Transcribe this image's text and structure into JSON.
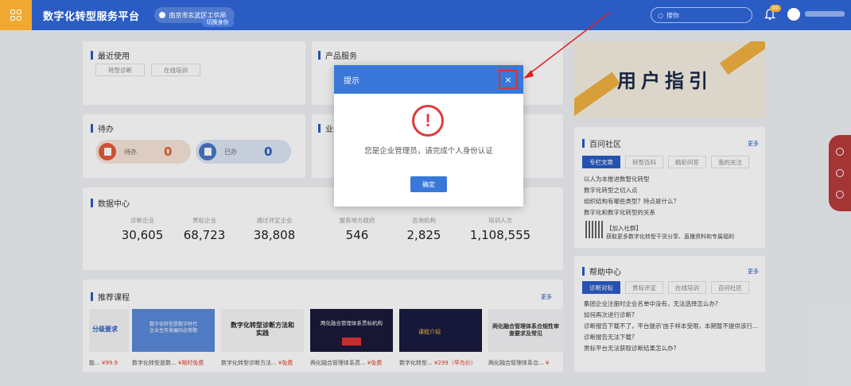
{
  "app": {
    "title": "数字化转型服务平台",
    "org": "南京市玄武区工信局",
    "org_sub": "切换身份"
  },
  "topbar": {
    "search_placeholder": "搜你"
  },
  "recent": {
    "title": "最近使用",
    "items": [
      "转型诊断",
      "在线培训"
    ]
  },
  "products": {
    "title": "产品服务"
  },
  "todo": {
    "title": "待办",
    "pending_label": "待办",
    "pending_count": "0",
    "done_label": "已办",
    "done_count": "0"
  },
  "business": {
    "title": "业务"
  },
  "data_center": {
    "title": "数据中心",
    "stats": [
      {
        "label": "诊断企业",
        "value": "30,605"
      },
      {
        "label": "贯标企业",
        "value": "68,723"
      },
      {
        "label": "通过评定企业",
        "value": "38,808"
      },
      {
        "label": "服务地方政府",
        "value": "546"
      },
      {
        "label": "咨询机构",
        "value": "2,825"
      },
      {
        "label": "培训人次",
        "value": "1,108,555"
      }
    ]
  },
  "courses": {
    "title": "推荐课程",
    "more": "更多",
    "items": [
      {
        "name": "能...",
        "price": "¥99.9"
      },
      {
        "name": "数字化转型是数...",
        "price": "¥限时免费"
      },
      {
        "name": "数字化转型诊断方法...",
        "price": "¥免费"
      },
      {
        "name": "两化融合管理体系贯...",
        "price": "¥免费"
      },
      {
        "name": "数字化转型...",
        "price": "¥299（早鸟价）"
      },
      {
        "name": "两化融合管理体系合...",
        "price": "¥"
      }
    ],
    "thumb_texts": [
      "分级要求",
      "数字化转型是数字时代企业生存发展的必答题",
      "数字化转型诊断方法和实践",
      "两化融合管理体系贯标机构",
      "课程介绍",
      "两化融合管理体系合规性审查要求及常见"
    ]
  },
  "guide": {
    "title": "用户指引"
  },
  "community": {
    "title": "百问社区",
    "more": "更多",
    "tabs": [
      "专栏文章",
      "转型百科",
      "精彩问答",
      "我的关注"
    ],
    "lines": [
      "以人为本推进数智化转型",
      "数字化转型之切入点",
      "组织结构有哪些类型？特点是什么？",
      "数字化和数字化转型的关系"
    ],
    "qr_title": "【加入社群】",
    "qr_desc": "获取更多数字化转型干货分享、直播资料和专属福利"
  },
  "help": {
    "title": "帮助中心",
    "more": "更多",
    "tabs": [
      "诊断对标",
      "贯标评定",
      "在线培训",
      "百问社区"
    ],
    "lines": [
      "集团企业注册时企业名单中没有，无法选择怎么办?",
      "如何再次进行诊断?",
      "诊断报告下载不了，平台提示'由于样本受限，本期暂不提供该行...",
      "诊断报告无法下载?",
      "贯标平台无法获取诊断结果怎么办?"
    ]
  },
  "modal": {
    "title": "提示",
    "close": "×",
    "icon": "!",
    "message": "您是企业管理员，请完成个人身份认证",
    "ok": "确定"
  },
  "colors": {
    "primary": "#2a5cc4",
    "modal_head": "#3978d8",
    "alert": "#e03a3a",
    "orange": "#f0a830"
  }
}
